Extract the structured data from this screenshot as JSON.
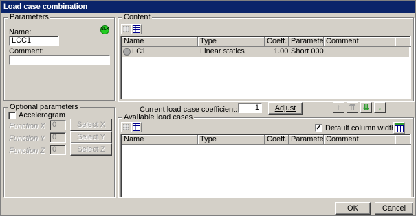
{
  "window": {
    "title": "Load case combination"
  },
  "parameters": {
    "group_label": "Parameters",
    "name_label": "Name:",
    "name_value": "LCC1",
    "badge": "SLK",
    "comment_label": "Comment:",
    "comment_value": ""
  },
  "optional": {
    "group_label": "Optional parameters",
    "accelerogram_label": "Accelerogram",
    "functions": [
      {
        "label": "Function X",
        "value": "0",
        "button": "Select X"
      },
      {
        "label": "Function Y",
        "value": "0",
        "button": "Select Y"
      },
      {
        "label": "Function Z",
        "value": "0",
        "button": "Select Z"
      }
    ]
  },
  "content": {
    "group_label": "Content",
    "columns": [
      "Name",
      "Type",
      "Coeff.",
      "Parameters",
      "Comment"
    ],
    "rows": [
      {
        "name": "LC1",
        "type": "Linear statics",
        "coeff": "1.00",
        "parameters": "Short  000",
        "comment": ""
      }
    ]
  },
  "coefficient": {
    "label": "Current load case coefficient:",
    "value": "1",
    "adjust_label": "Adjust"
  },
  "available": {
    "group_label": "Available load cases",
    "default_width_label": "Default column width",
    "default_width_checked": true,
    "columns": [
      "Name",
      "Type",
      "Coeff.",
      "Parameters",
      "Comment"
    ]
  },
  "footer": {
    "ok_label": "OK",
    "cancel_label": "Cancel"
  },
  "colors": {
    "title_bar": "#0a246a",
    "badge": "#22cc22",
    "arrow_green": "#2e9a2e"
  }
}
